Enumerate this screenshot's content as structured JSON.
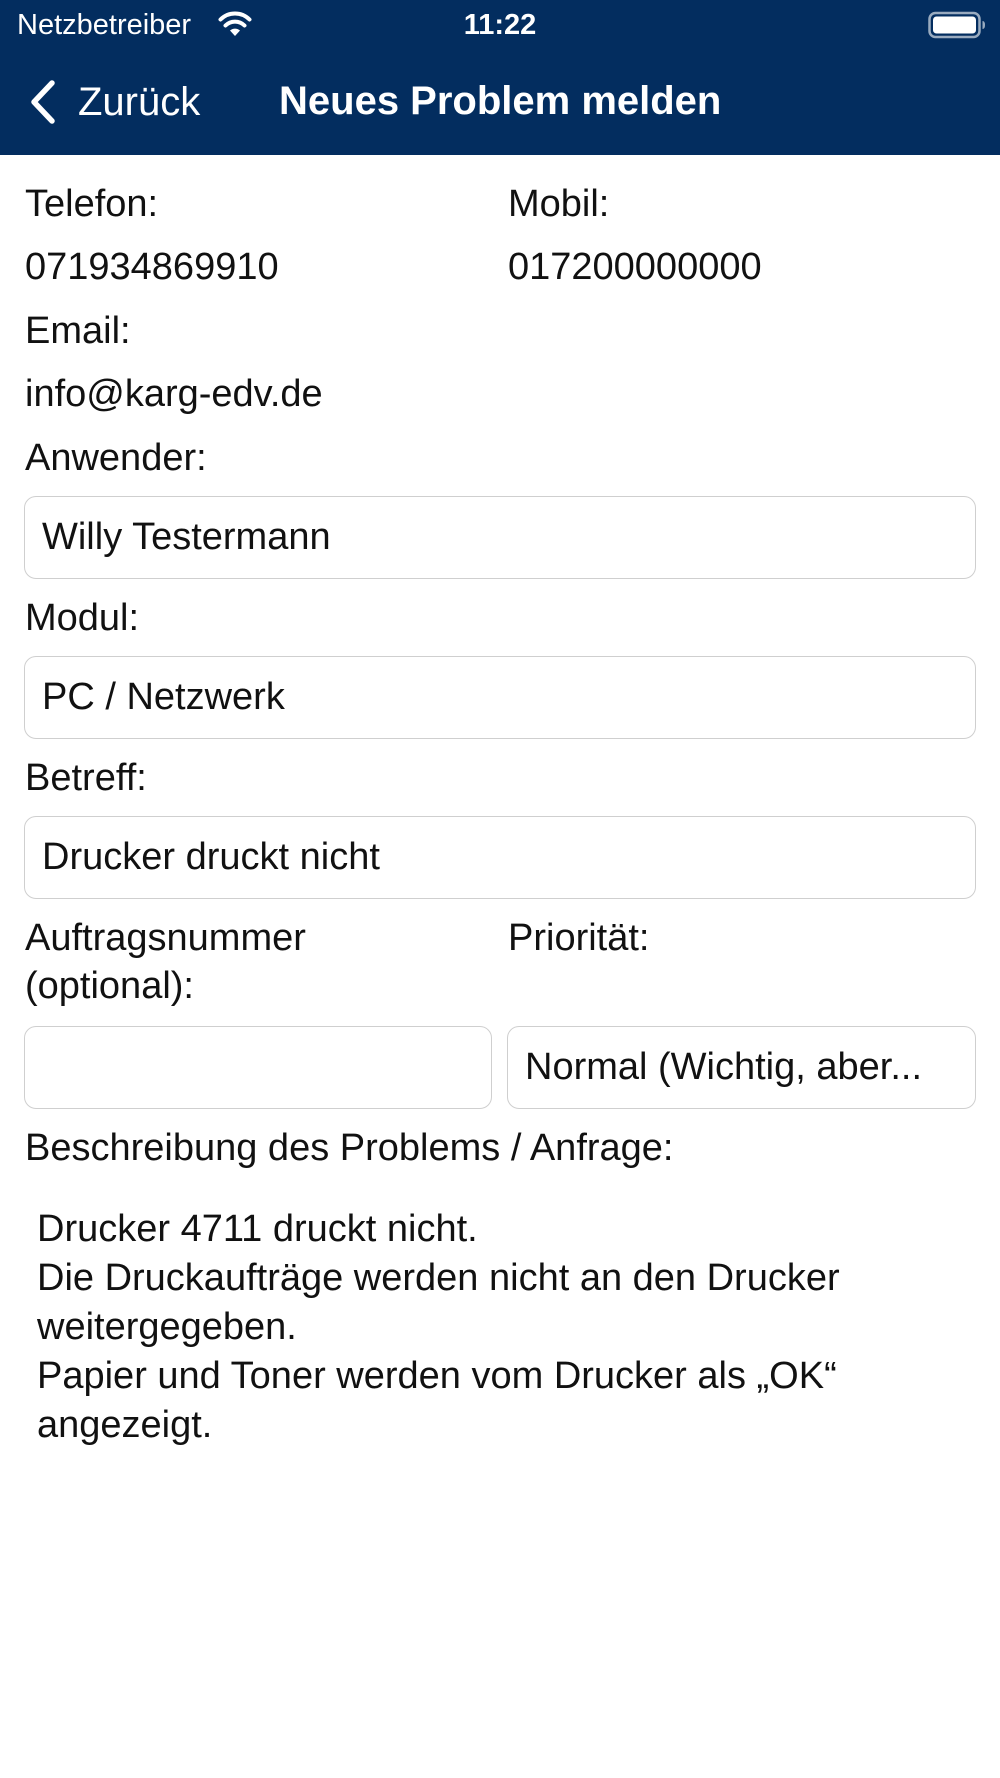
{
  "status_bar": {
    "carrier": "Netzbetreiber",
    "time": "11:22",
    "wifi_icon": "wifi-icon",
    "battery_icon": "battery-icon"
  },
  "nav": {
    "back_label": "Zurück",
    "back_icon": "chevron-left-icon",
    "title": "Neues Problem melden"
  },
  "colors": {
    "header_background": "#032d5f",
    "header_text": "#ffffff",
    "field_border": "#cfcfcf"
  },
  "form": {
    "telefon_label": "Telefon:",
    "telefon_value": "071934869910",
    "mobil_label": "Mobil:",
    "mobil_value": "017200000000",
    "email_label": "Email:",
    "email_value": "info@karg-edv.de",
    "anwender_label": "Anwender:",
    "anwender_value": "Willy Testermann",
    "modul_label": "Modul:",
    "modul_value": "PC / Netzwerk",
    "betreff_label": "Betreff:",
    "betreff_value": "Drucker druckt nicht",
    "auftragsnummer_label_line1": "Auftragsnummer",
    "auftragsnummer_label_line2": "(optional):",
    "auftragsnummer_value": "",
    "prioritaet_label": "Priorität:",
    "prioritaet_value": "Normal (Wichtig, aber...",
    "beschreibung_label": "Beschreibung des Problems / Anfrage:",
    "beschreibung_lines": [
      "Drucker 4711 druckt nicht.",
      "Die Druckaufträge werden nicht an den Drucker",
      "weitergegeben.",
      "Papier und Toner werden vom Drucker als „OK“",
      "angezeigt."
    ]
  }
}
